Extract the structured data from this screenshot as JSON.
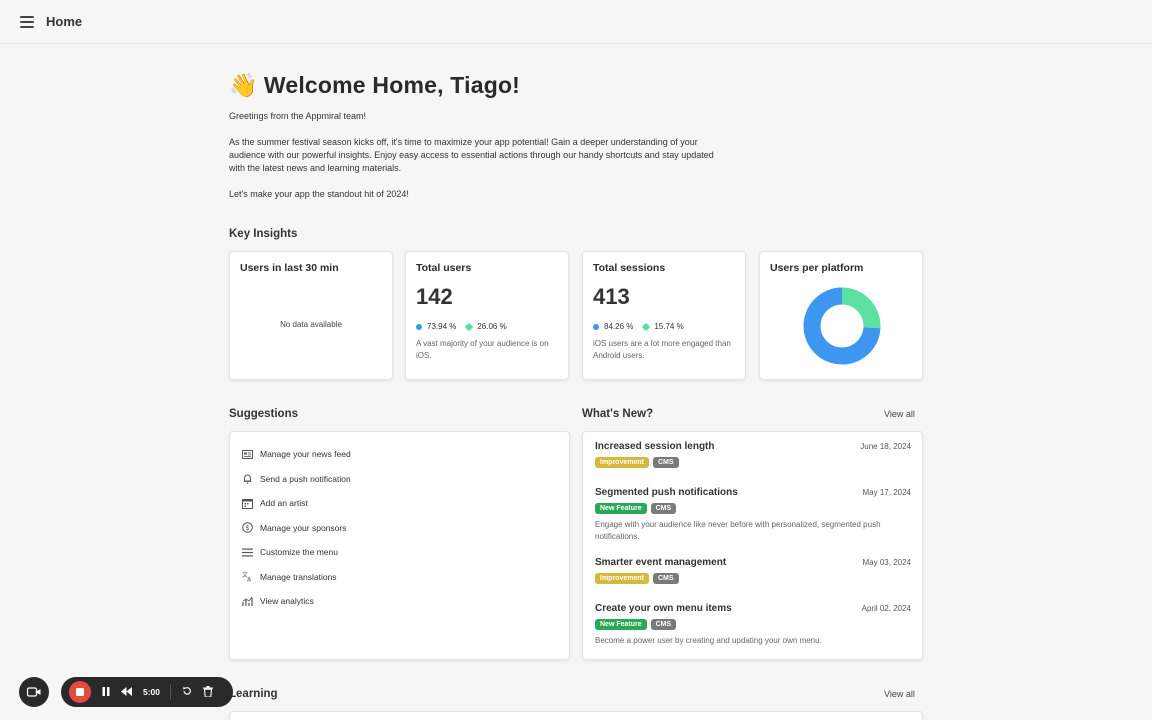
{
  "header": {
    "title": "Home"
  },
  "welcome": {
    "emoji": "👋",
    "title": "Welcome Home, Tiago!",
    "greeting": "Greetings from the Appmiral team!",
    "body": "As the summer festival season kicks off, it's time to maximize your app potential! Gain a deeper understanding of your audience with our powerful insights. Enjoy easy access to essential actions through our handy shortcuts and stay updated with the latest news and learning materials.",
    "closing": "Let's make your app the standout hit of 2024!"
  },
  "insights": {
    "title": "Key Insights",
    "last30": {
      "title": "Users in last 30 min",
      "empty": "No data available"
    },
    "total_users": {
      "title": "Total users",
      "value": "142",
      "ios": "73.94 %",
      "android": "26.06 %",
      "note": "A vast majority of your audience is on iOS."
    },
    "total_sessions": {
      "title": "Total sessions",
      "value": "413",
      "ios": "84.26 %",
      "android": "15.74 %",
      "note": "iOS users are a lot more engaged than Android users."
    },
    "platform": {
      "title": "Users per platform"
    }
  },
  "chart_data": {
    "type": "pie",
    "title": "Users per platform",
    "categories": [
      "iOS",
      "Android"
    ],
    "values": [
      73.94,
      26.06
    ],
    "colors": [
      "#3d97f0",
      "#5ce0a1"
    ]
  },
  "suggestions": {
    "title": "Suggestions",
    "items": [
      {
        "label": "Manage your news feed",
        "icon": "newspaper-icon"
      },
      {
        "label": "Send a push notification",
        "icon": "bell-icon"
      },
      {
        "label": "Add an artist",
        "icon": "calendar-icon"
      },
      {
        "label": "Manage your sponsors",
        "icon": "dollar-icon"
      },
      {
        "label": "Customize the menu",
        "icon": "menu-lines-icon"
      },
      {
        "label": "Manage translations",
        "icon": "translate-icon"
      },
      {
        "label": "View analytics",
        "icon": "chart-icon"
      }
    ]
  },
  "news": {
    "title": "What's New?",
    "view_all": "View all",
    "items": [
      {
        "title": "Increased session length",
        "date": "June 18, 2024",
        "tags": [
          "Improvement",
          "CMS"
        ],
        "desc": ""
      },
      {
        "title": "Segmented push notifications",
        "date": "May 17, 2024",
        "tags": [
          "New Feature",
          "CMS"
        ],
        "desc": "Engage with your audience like never before with personalized, segmented push notifications."
      },
      {
        "title": "Smarter event management",
        "date": "May 03, 2024",
        "tags": [
          "Improvement",
          "CMS"
        ],
        "desc": ""
      },
      {
        "title": "Create your own menu items",
        "date": "April 02, 2024",
        "tags": [
          "New Feature",
          "CMS"
        ],
        "desc": "Become a power user by creating and updating your own menu."
      }
    ]
  },
  "learning": {
    "title": "Learning",
    "view_all": "View all"
  },
  "recorder": {
    "time": "5:00"
  }
}
